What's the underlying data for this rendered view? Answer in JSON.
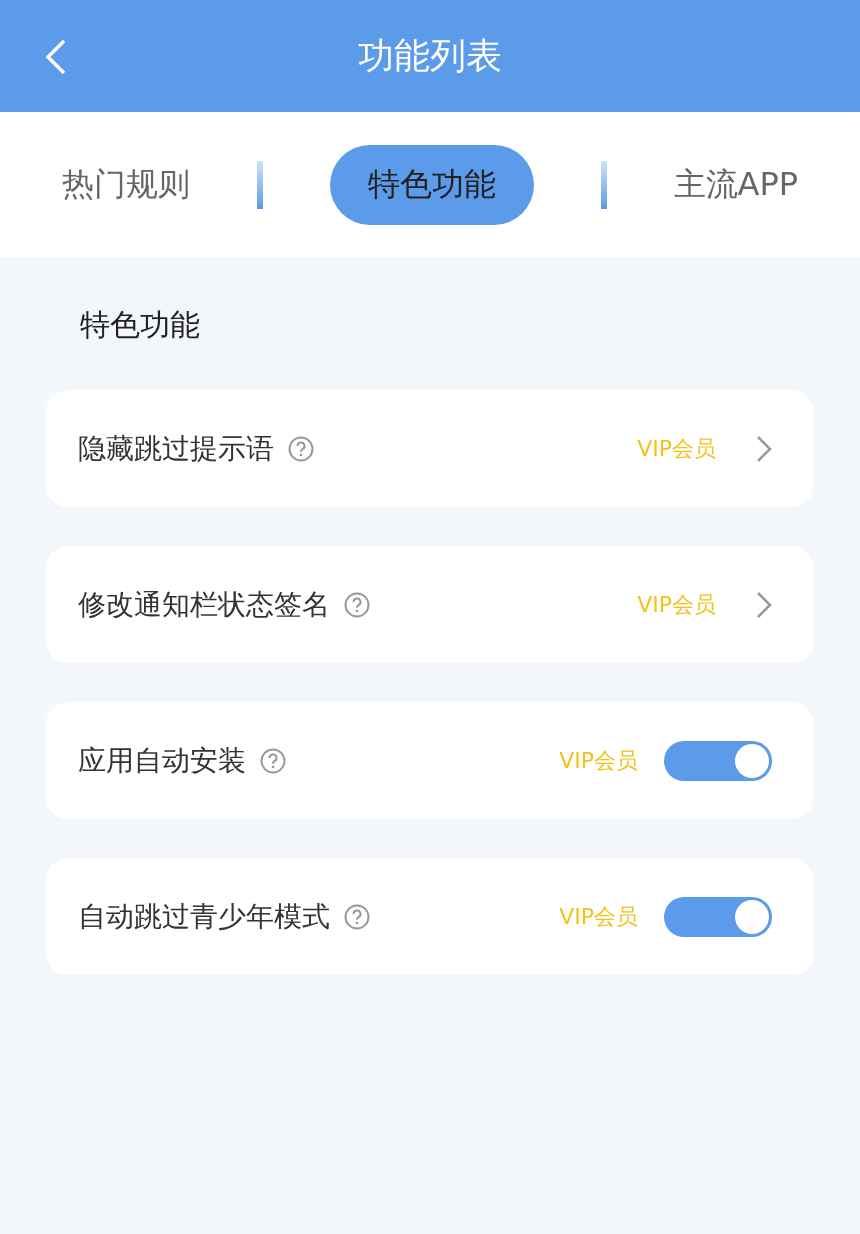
{
  "header": {
    "title": "功能列表"
  },
  "tabs": [
    {
      "label": "热门规则",
      "selected": false
    },
    {
      "label": "特色功能",
      "selected": true
    },
    {
      "label": "主流APP",
      "selected": false
    }
  ],
  "section": {
    "title": "特色功能"
  },
  "items": [
    {
      "kind": "link",
      "label": "隐藏跳过提示语",
      "badge": "VIP会员"
    },
    {
      "kind": "link",
      "label": "修改通知栏状态签名",
      "badge": "VIP会员"
    },
    {
      "kind": "toggle",
      "label": "应用自动安装",
      "badge": "VIP会员",
      "on": true
    },
    {
      "kind": "toggle",
      "label": "自动跳过青少年模式",
      "badge": "VIP会员",
      "on": true
    }
  ]
}
